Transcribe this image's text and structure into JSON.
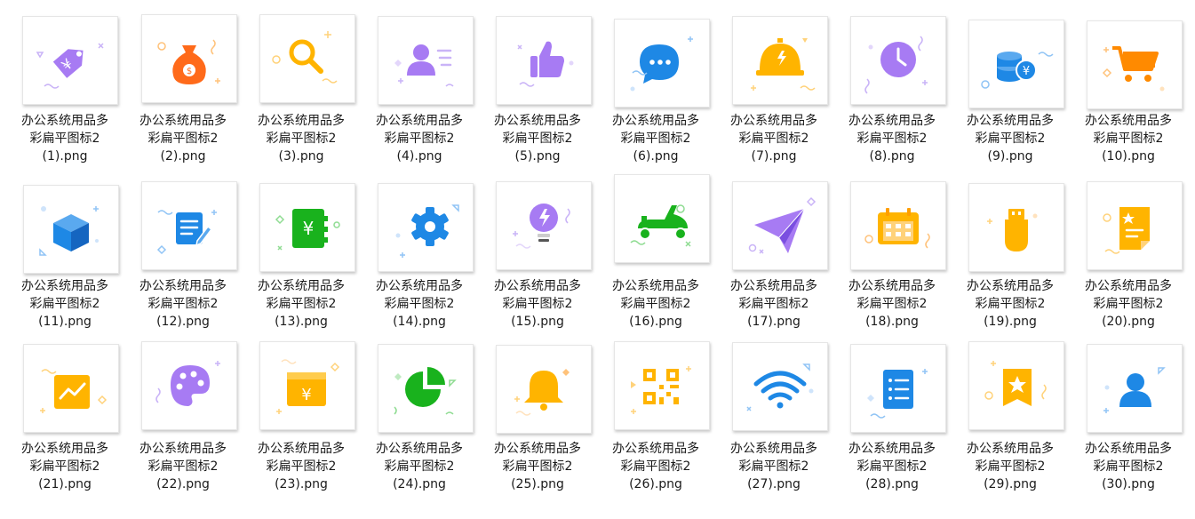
{
  "files": [
    {
      "line1": "办公系统用品多",
      "line2": "彩扁平图标2",
      "line3": "(1).png",
      "icon": "price-tag-yuan-icon",
      "color": "#a77bf3"
    },
    {
      "line1": "办公系统用品多",
      "line2": "彩扁平图标2",
      "line3": "(2).png",
      "icon": "money-bag-icon",
      "color": "#ff6a1a"
    },
    {
      "line1": "办公系统用品多",
      "line2": "彩扁平图标2",
      "line3": "(3).png",
      "icon": "magnifier-icon",
      "color": "#ffb400"
    },
    {
      "line1": "办公系统用品多",
      "line2": "彩扁平图标2",
      "line3": "(4).png",
      "icon": "user-list-icon",
      "color": "#a77bf3"
    },
    {
      "line1": "办公系统用品多",
      "line2": "彩扁平图标2",
      "line3": "(5).png",
      "icon": "thumbs-up-icon",
      "color": "#a77bf3"
    },
    {
      "line1": "办公系统用品多",
      "line2": "彩扁平图标2",
      "line3": "(6).png",
      "icon": "chat-bubble-icon",
      "color": "#1e88e5"
    },
    {
      "line1": "办公系统用品多",
      "line2": "彩扁平图标2",
      "line3": "(7).png",
      "icon": "service-bell-icon",
      "color": "#ffb400"
    },
    {
      "line1": "办公系统用品多",
      "line2": "彩扁平图标2",
      "line3": "(8).png",
      "icon": "clock-icon",
      "color": "#a77bf3"
    },
    {
      "line1": "办公系统用品多",
      "line2": "彩扁平图标2",
      "line3": "(9).png",
      "icon": "coins-yuan-icon",
      "color": "#1e88e5"
    },
    {
      "line1": "办公系统用品多",
      "line2": "彩扁平图标2",
      "line3": "(10).png",
      "icon": "shopping-cart-icon",
      "color": "#ff8a00"
    },
    {
      "line1": "办公系统用品多",
      "line2": "彩扁平图标2",
      "line3": "(11).png",
      "icon": "cube-box-icon",
      "color": "#1e88e5"
    },
    {
      "line1": "办公系统用品多",
      "line2": "彩扁平图标2",
      "line3": "(12).png",
      "icon": "note-pencil-icon",
      "color": "#1e88e5"
    },
    {
      "line1": "办公系统用品多",
      "line2": "彩扁平图标2",
      "line3": "(13).png",
      "icon": "ledger-yuan-icon",
      "color": "#19b21d"
    },
    {
      "line1": "办公系统用品多",
      "line2": "彩扁平图标2",
      "line3": "(14).png",
      "icon": "gear-icon",
      "color": "#1e88e5"
    },
    {
      "line1": "办公系统用品多",
      "line2": "彩扁平图标2",
      "line3": "(15).png",
      "icon": "light-bulb-icon",
      "color": "#a77bf3"
    },
    {
      "line1": "办公系统用品多",
      "line2": "彩扁平图标2",
      "line3": "(16).png",
      "icon": "scooter-icon",
      "color": "#19b21d"
    },
    {
      "line1": "办公系统用品多",
      "line2": "彩扁平图标2",
      "line3": "(17).png",
      "icon": "paper-plane-icon",
      "color": "#a77bf3"
    },
    {
      "line1": "办公系统用品多",
      "line2": "彩扁平图标2",
      "line3": "(18).png",
      "icon": "calendar-icon",
      "color": "#ffb400"
    },
    {
      "line1": "办公系统用品多",
      "line2": "彩扁平图标2",
      "line3": "(19).png",
      "icon": "usb-drive-icon",
      "color": "#ffb400"
    },
    {
      "line1": "办公系统用品多",
      "line2": "彩扁平图标2",
      "line3": "(20).png",
      "icon": "document-star-icon",
      "color": "#ffb400"
    },
    {
      "line1": "办公系统用品多",
      "line2": "彩扁平图标2",
      "line3": "(21).png",
      "icon": "line-chart-icon",
      "color": "#ffb400"
    },
    {
      "line1": "办公系统用品多",
      "line2": "彩扁平图标2",
      "line3": "(22).png",
      "icon": "palette-icon",
      "color": "#a77bf3"
    },
    {
      "line1": "办公系统用品多",
      "line2": "彩扁平图标2",
      "line3": "(23).png",
      "icon": "wallet-yuan-icon",
      "color": "#ffb400"
    },
    {
      "line1": "办公系统用品多",
      "line2": "彩扁平图标2",
      "line3": "(24).png",
      "icon": "pie-chart-icon",
      "color": "#19b21d"
    },
    {
      "line1": "办公系统用品多",
      "line2": "彩扁平图标2",
      "line3": "(25).png",
      "icon": "bell-icon",
      "color": "#ffb400"
    },
    {
      "line1": "办公系统用品多",
      "line2": "彩扁平图标2",
      "line3": "(26).png",
      "icon": "qr-code-icon",
      "color": "#ffb400"
    },
    {
      "line1": "办公系统用品多",
      "line2": "彩扁平图标2",
      "line3": "(27).png",
      "icon": "wifi-icon",
      "color": "#1e88e5"
    },
    {
      "line1": "办公系统用品多",
      "line2": "彩扁平图标2",
      "line3": "(28).png",
      "icon": "list-document-icon",
      "color": "#1e88e5"
    },
    {
      "line1": "办公系统用品多",
      "line2": "彩扁平图标2",
      "line3": "(29).png",
      "icon": "star-bookmark-icon",
      "color": "#ffb400"
    },
    {
      "line1": "办公系统用品多",
      "line2": "彩扁平图标2",
      "line3": "(30).png",
      "icon": "user-avatar-icon",
      "color": "#1e88e5"
    }
  ]
}
